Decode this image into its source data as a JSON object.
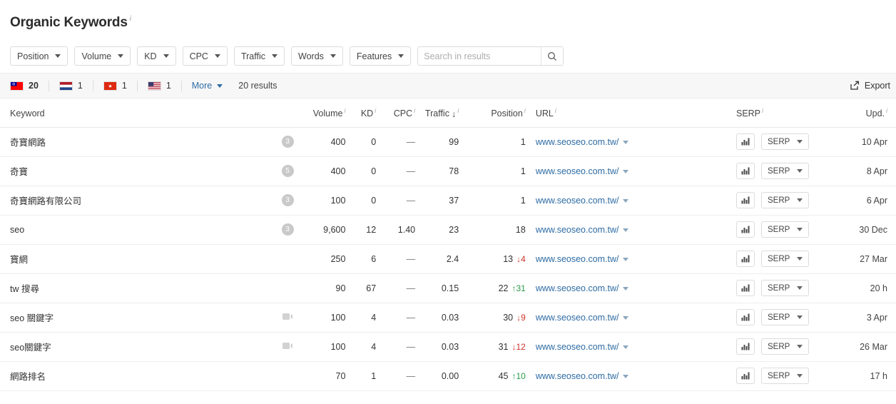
{
  "header": {
    "title": "Organic Keywords",
    "info_marker": "i"
  },
  "filters": {
    "buttons": [
      {
        "label": "Position",
        "name": "filter-position"
      },
      {
        "label": "Volume",
        "name": "filter-volume"
      },
      {
        "label": "KD",
        "name": "filter-kd"
      },
      {
        "label": "CPC",
        "name": "filter-cpc"
      },
      {
        "label": "Traffic",
        "name": "filter-traffic"
      },
      {
        "label": "Words",
        "name": "filter-words"
      },
      {
        "label": "Features",
        "name": "filter-features"
      }
    ],
    "search": {
      "placeholder": "Search in results",
      "value": "",
      "icon": "search-icon"
    }
  },
  "country_bar": {
    "countries": [
      {
        "code": "TW",
        "name": "taiwan",
        "count": "20",
        "bold": true
      },
      {
        "code": "NL",
        "name": "netherlands",
        "count": "1",
        "bold": false
      },
      {
        "code": "HK",
        "name": "hong-kong",
        "count": "1",
        "bold": false
      },
      {
        "code": "US",
        "name": "united-states",
        "count": "1",
        "bold": false
      }
    ],
    "more_label": "More",
    "results_label": "20 results",
    "export_label": "Export",
    "export_icon": "share-export-icon"
  },
  "table": {
    "columns": [
      {
        "key": "keyword",
        "label": "Keyword",
        "info": ""
      },
      {
        "key": "features",
        "label": "",
        "info": ""
      },
      {
        "key": "volume",
        "label": "Volume",
        "info": "i"
      },
      {
        "key": "kd",
        "label": "KD",
        "info": "i"
      },
      {
        "key": "cpc",
        "label": "CPC",
        "info": "i"
      },
      {
        "key": "traffic",
        "label": "Traffic",
        "info": "i",
        "sort": "desc"
      },
      {
        "key": "position",
        "label": "Position",
        "info": "i"
      },
      {
        "key": "url",
        "label": "URL",
        "info": "i"
      },
      {
        "key": "serp",
        "label": "SERP",
        "info": "i"
      },
      {
        "key": "upd",
        "label": "Upd.",
        "info": "i"
      }
    ],
    "serp_button_label": "SERP",
    "rows": [
      {
        "keyword": "奇寶網路",
        "feature_badge": "3",
        "feature_type": "count",
        "volume": "400",
        "kd": "0",
        "cpc": "—",
        "traffic": "99",
        "position": "1",
        "delta": "",
        "delta_dir": "",
        "url": "www.seoseo.com.tw/",
        "upd": "10 Apr"
      },
      {
        "keyword": "奇寶",
        "feature_badge": "5",
        "feature_type": "count",
        "volume": "400",
        "kd": "0",
        "cpc": "—",
        "traffic": "78",
        "position": "1",
        "delta": "",
        "delta_dir": "",
        "url": "www.seoseo.com.tw/",
        "upd": "8 Apr"
      },
      {
        "keyword": "奇寶網路有限公司",
        "feature_badge": "3",
        "feature_type": "count",
        "volume": "100",
        "kd": "0",
        "cpc": "—",
        "traffic": "37",
        "position": "1",
        "delta": "",
        "delta_dir": "",
        "url": "www.seoseo.com.tw/",
        "upd": "6 Apr"
      },
      {
        "keyword": "seo",
        "feature_badge": "3",
        "feature_type": "count",
        "volume": "9,600",
        "kd": "12",
        "cpc": "1.40",
        "traffic": "23",
        "position": "18",
        "delta": "",
        "delta_dir": "",
        "url": "www.seoseo.com.tw/",
        "upd": "30 Dec"
      },
      {
        "keyword": "寶網",
        "feature_badge": "",
        "feature_type": "none",
        "volume": "250",
        "kd": "6",
        "cpc": "—",
        "traffic": "2.4",
        "position": "13",
        "delta": "4",
        "delta_dir": "down",
        "url": "www.seoseo.com.tw/",
        "upd": "27 Mar"
      },
      {
        "keyword": "tw 搜尋",
        "feature_badge": "",
        "feature_type": "none",
        "volume": "90",
        "kd": "67",
        "cpc": "—",
        "traffic": "0.15",
        "position": "22",
        "delta": "31",
        "delta_dir": "up",
        "url": "www.seoseo.com.tw/",
        "upd": "20 h"
      },
      {
        "keyword": "seo 關鍵字",
        "feature_badge": "",
        "feature_type": "video",
        "volume": "100",
        "kd": "4",
        "cpc": "—",
        "traffic": "0.03",
        "position": "30",
        "delta": "9",
        "delta_dir": "down",
        "url": "www.seoseo.com.tw/",
        "upd": "3 Apr"
      },
      {
        "keyword": "seo關鍵字",
        "feature_badge": "",
        "feature_type": "video",
        "volume": "100",
        "kd": "4",
        "cpc": "—",
        "traffic": "0.03",
        "position": "31",
        "delta": "12",
        "delta_dir": "down",
        "url": "www.seoseo.com.tw/",
        "upd": "26 Mar"
      },
      {
        "keyword": "網路排名",
        "feature_badge": "",
        "feature_type": "none",
        "volume": "70",
        "kd": "1",
        "cpc": "—",
        "traffic": "0.00",
        "position": "45",
        "delta": "10",
        "delta_dir": "up",
        "url": "www.seoseo.com.tw/",
        "upd": "17 h"
      }
    ]
  },
  "colors": {
    "link": "#2e6ca4",
    "delta_down": "#d0342c",
    "delta_up": "#2a9a4a",
    "badge_gray": "#c9c9c9",
    "bar_bg": "#f7f7f7"
  }
}
